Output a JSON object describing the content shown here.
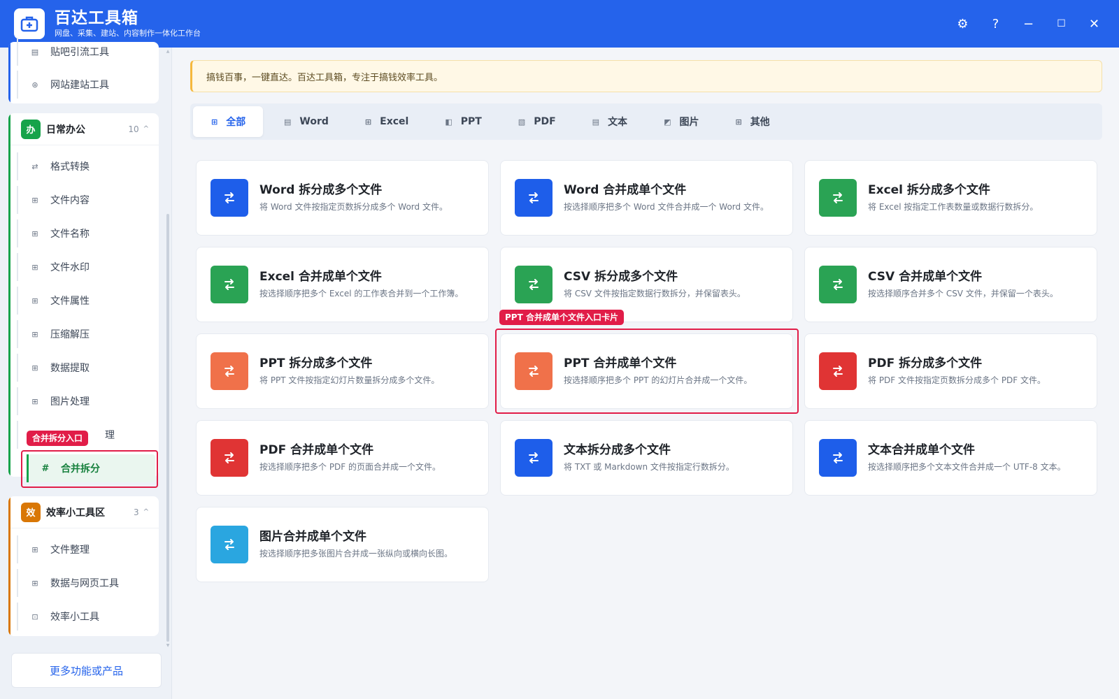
{
  "app": {
    "title": "百达工具箱",
    "subtitle": "网盘、采集、建站、内容制作一体化工作台"
  },
  "window_controls": {
    "settings": "⚙",
    "help": "?",
    "minimize": "−",
    "maximize": "☐",
    "close": "✕"
  },
  "sidebar": {
    "top_group": {
      "items": [
        {
          "label": "贴吧引流工具",
          "icon": "▤"
        },
        {
          "label": "网站建站工具",
          "icon": "⊛"
        }
      ]
    },
    "office_group": {
      "badge": "办",
      "title": "日常办公",
      "count": "10",
      "caret": "^",
      "color": "#16a34a",
      "items": [
        {
          "label": "格式转换",
          "icon": "⇄"
        },
        {
          "label": "文件内容",
          "icon": "⊞"
        },
        {
          "label": "文件名称",
          "icon": "⊞"
        },
        {
          "label": "文件水印",
          "icon": "⊞"
        },
        {
          "label": "文件属性",
          "icon": "⊞"
        },
        {
          "label": "压缩解压",
          "icon": "⊞"
        },
        {
          "label": "数据提取",
          "icon": "⊞"
        },
        {
          "label": "图片处理",
          "icon": "⊞"
        },
        {
          "label": "理",
          "icon": "⊞"
        },
        {
          "label": "合并拆分",
          "icon": "#"
        }
      ]
    },
    "efficiency_group": {
      "badge": "效",
      "title": "效率小工具区",
      "count": "3",
      "caret": "^",
      "color": "#d97706",
      "items": [
        {
          "label": "文件整理",
          "icon": "⊞"
        },
        {
          "label": "数据与网页工具",
          "icon": "⊞"
        },
        {
          "label": "效率小工具",
          "icon": "⊡"
        }
      ]
    },
    "more_button": "更多功能或产品"
  },
  "annotations": {
    "sidebar_tag": "合并拆分入口",
    "card_tag": "PPT 合并成单个文件入口卡片"
  },
  "notice": "搞钱百事，一键直达。百达工具箱，专注于搞钱效率工具。",
  "tabs": [
    {
      "label": "全部",
      "icon": "⊞"
    },
    {
      "label": "Word",
      "icon": "▤"
    },
    {
      "label": "Excel",
      "icon": "⊞"
    },
    {
      "label": "PPT",
      "icon": "◧"
    },
    {
      "label": "PDF",
      "icon": "▧"
    },
    {
      "label": "文本",
      "icon": "▤"
    },
    {
      "label": "图片",
      "icon": "◩"
    },
    {
      "label": "其他",
      "icon": "⊞"
    }
  ],
  "cards": [
    {
      "title": "Word 拆分成多个文件",
      "desc": "将 Word 文件按指定页数拆分成多个 Word 文件。",
      "color": "#1e5eea"
    },
    {
      "title": "Word 合并成单个文件",
      "desc": "按选择顺序把多个 Word 文件合并成一个 Word 文件。",
      "color": "#1e5eea"
    },
    {
      "title": "Excel 拆分成多个文件",
      "desc": "将 Excel 按指定工作表数量或数据行数拆分。",
      "color": "#2aa354"
    },
    {
      "title": "Excel 合并成单个文件",
      "desc": "按选择顺序把多个 Excel 的工作表合并到一个工作簿。",
      "color": "#2aa354"
    },
    {
      "title": "CSV 拆分成多个文件",
      "desc": "将 CSV 文件按指定数据行数拆分，并保留表头。",
      "color": "#2aa354"
    },
    {
      "title": "CSV 合并成单个文件",
      "desc": "按选择顺序合并多个 CSV 文件，并保留一个表头。",
      "color": "#2aa354"
    },
    {
      "title": "PPT 拆分成多个文件",
      "desc": "将 PPT 文件按指定幻灯片数量拆分成多个文件。",
      "color": "#f0714a"
    },
    {
      "title": "PPT 合并成单个文件",
      "desc": "按选择顺序把多个 PPT 的幻灯片合并成一个文件。",
      "color": "#f0714a"
    },
    {
      "title": "PDF 拆分成多个文件",
      "desc": "将 PDF 文件按指定页数拆分成多个 PDF 文件。",
      "color": "#e03434"
    },
    {
      "title": "PDF 合并成单个文件",
      "desc": "按选择顺序把多个 PDF 的页面合并成一个文件。",
      "color": "#e03434"
    },
    {
      "title": "文本拆分成多个文件",
      "desc": "将 TXT 或 Markdown 文件按指定行数拆分。",
      "color": "#1e5eea"
    },
    {
      "title": "文本合并成单个文件",
      "desc": "按选择顺序把多个文本文件合并成一个 UTF-8 文本。",
      "color": "#1e5eea"
    },
    {
      "title": "图片合并成单个文件",
      "desc": "按选择顺序把多张图片合并成一张纵向或横向长图。",
      "color": "#2aa6e0"
    }
  ],
  "card_icon_glyph": "swap-arrows-icon"
}
